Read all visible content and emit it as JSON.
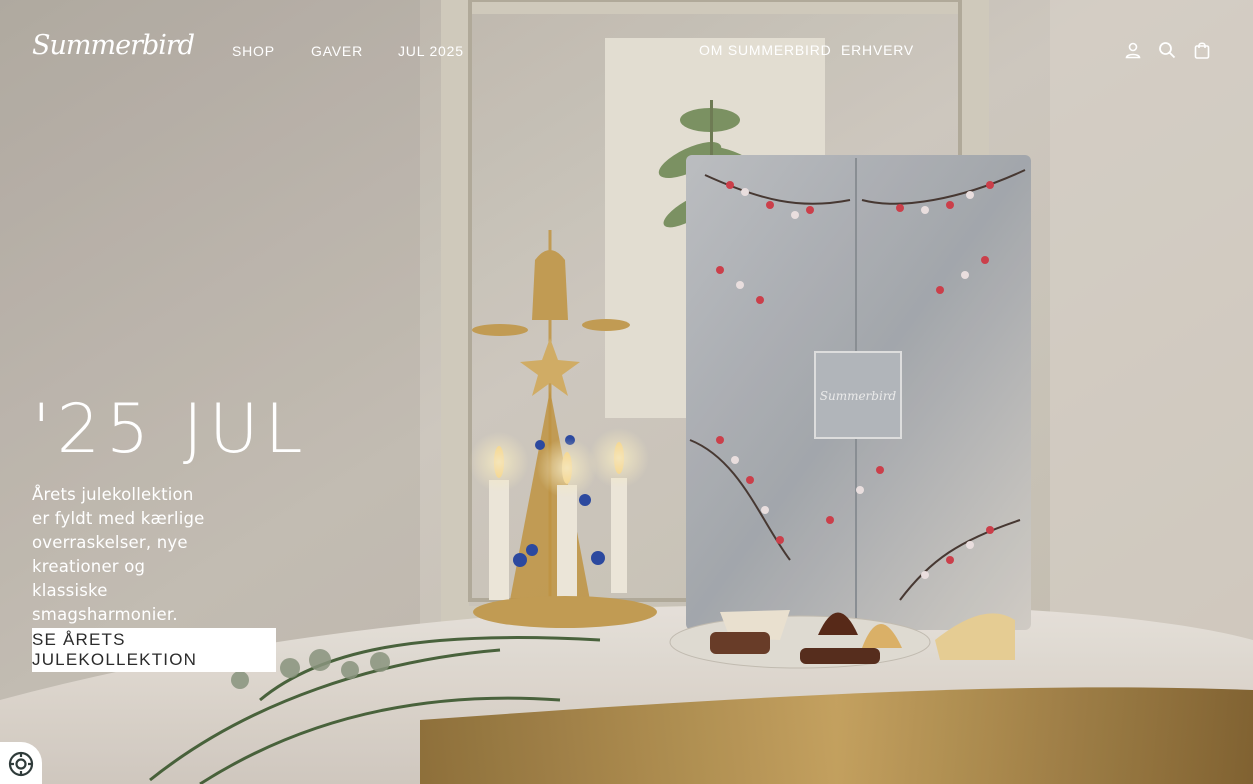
{
  "header": {
    "logo_text": "Summerbird",
    "nav": {
      "shop": "SHOP",
      "gaver": "GAVER",
      "jul": "JUL 2025",
      "om": "OM SUMMERBIRD",
      "erhverv": "ERHVERV"
    },
    "icons": [
      "account-icon",
      "search-icon",
      "bag-icon"
    ]
  },
  "hero": {
    "title": "'25 JUL",
    "subtitle": "Årets julekollektion er fyldt med kærlige overraskelser, nye kreationer og klassiske smagsharmonier.",
    "cta": "SE ÅRETS JULEKOLLEKTION",
    "box_logo": "Summerbird"
  },
  "colors": {
    "text": "#ffffff",
    "button_bg": "#ffffff",
    "button_text": "#2b2b2b"
  }
}
